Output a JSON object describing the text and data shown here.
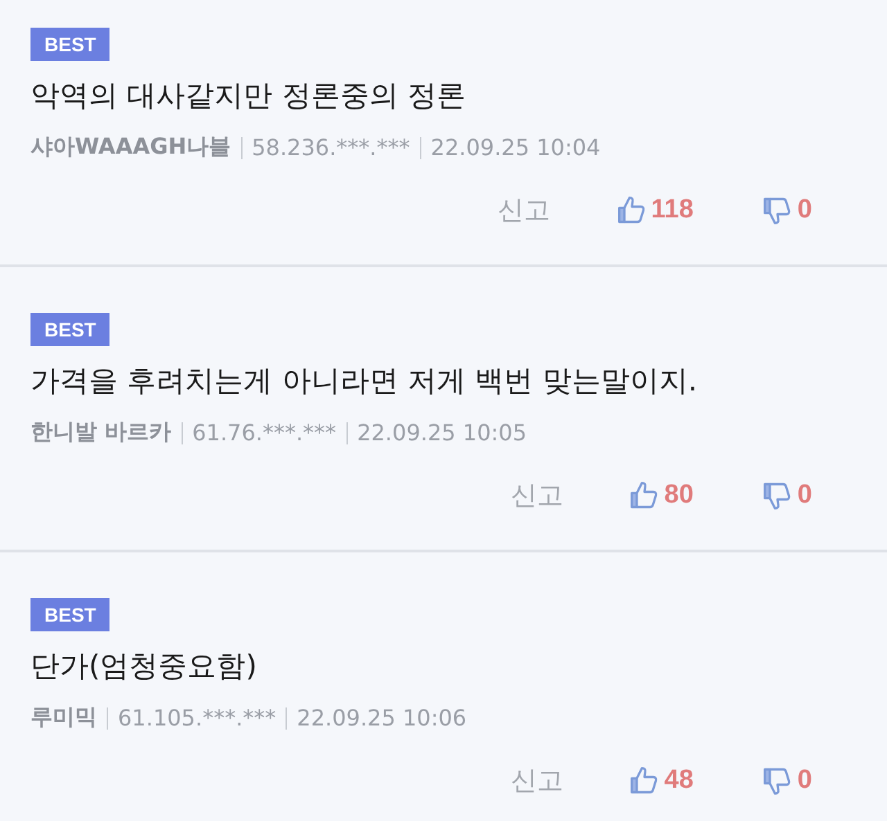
{
  "comments": [
    {
      "badge": "BEST",
      "text": "악역의 대사같지만 정론중의 정론",
      "author": "샤아WAAAGH나블",
      "ip": "58.236.***.***",
      "time": "22.09.25 10:04",
      "report": "신고",
      "likes": "118",
      "dislikes": "0"
    },
    {
      "badge": "BEST",
      "text": "가격을 후려치는게 아니라면 저게 백번 맞는말이지.",
      "author": "한니발 바르카",
      "ip": "61.76.***.***",
      "time": "22.09.25 10:05",
      "report": "신고",
      "likes": "80",
      "dislikes": "0"
    },
    {
      "badge": "BEST",
      "text": "단가(엄청중요함)",
      "author": "루미믹",
      "ip": "61.105.***.***",
      "time": "22.09.25 10:06",
      "report": "신고",
      "likes": "48",
      "dislikes": "0"
    }
  ]
}
